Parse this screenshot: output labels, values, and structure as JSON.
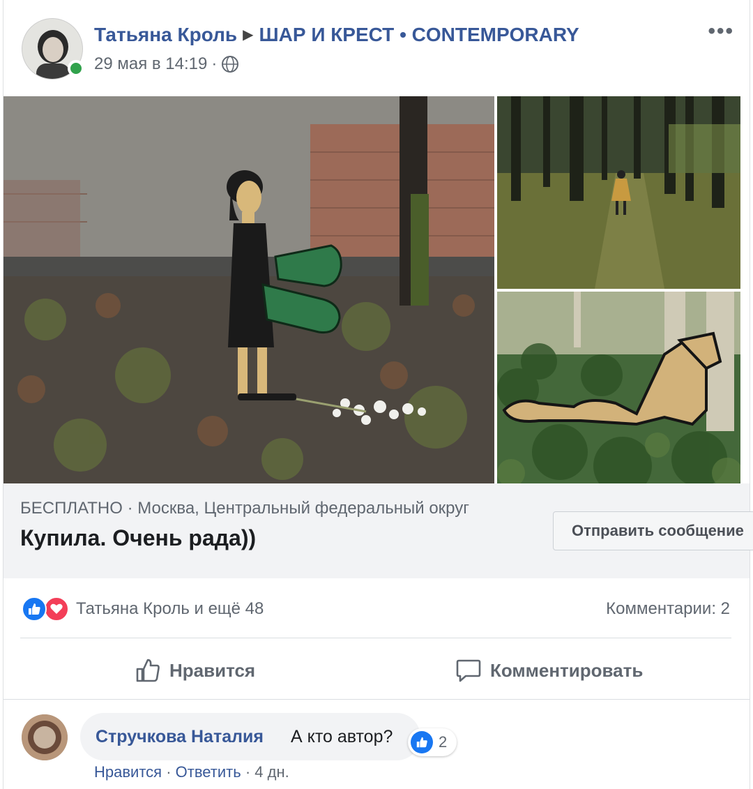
{
  "post": {
    "author": "Татьяна Кроль",
    "group": "ШАР И КРЕСТ • CONTEMPORARY",
    "timestamp": "29 мая в 14:19",
    "separator": "·",
    "more_label": "•••"
  },
  "listing": {
    "price": "БЕСПЛАТНО",
    "location": "Москва, Центральный федеральный округ",
    "meta_separator": "·",
    "title": "Купила. Очень рада))",
    "send_button": "Отправить сообщение"
  },
  "reactions": {
    "summary": "Татьяна Кроль и ещё 48",
    "comments_count": "Комментарии: 2"
  },
  "actions": {
    "like_label": "Нравится",
    "comment_label": "Комментировать"
  },
  "comment": {
    "author": "Стручкова Наталия",
    "text": "А кто автор?",
    "reaction_count": "2",
    "like_link": "Нравится",
    "reply_link": "Ответить",
    "age": "4 дн.",
    "separator": "·"
  },
  "colors": {
    "link_blue": "#385898",
    "facebook_blue": "#1877f2",
    "love_red": "#f33e58",
    "online_green": "#31a24c",
    "muted_gray": "#606770"
  },
  "icons": [
    "globe-icon",
    "more-icon",
    "like-reaction-icon",
    "love-reaction-icon",
    "thumbs-up-icon",
    "comment-icon"
  ]
}
